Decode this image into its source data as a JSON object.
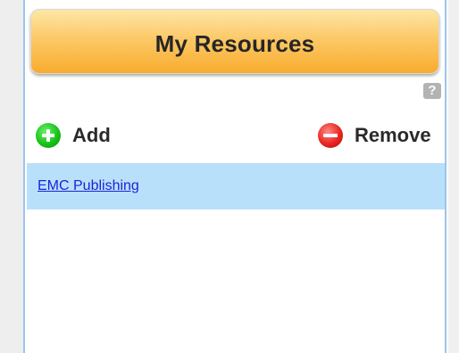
{
  "header": {
    "title": "My Resources"
  },
  "help": {
    "icon": "question-icon",
    "glyph": "?"
  },
  "toolbar": {
    "add_label": "Add",
    "add_icon": "plus-icon",
    "remove_label": "Remove",
    "remove_icon": "minus-icon"
  },
  "resources": [
    {
      "label": "EMC Publishing",
      "selected": true
    }
  ],
  "colors": {
    "header_top": "#fde7a6",
    "header_bottom": "#f8ac2e",
    "panel_border": "#9cc4ec",
    "selected_row": "#b9e0fb",
    "link": "#1a24d6",
    "add_green": "#18c318",
    "remove_red": "#e8261f"
  }
}
